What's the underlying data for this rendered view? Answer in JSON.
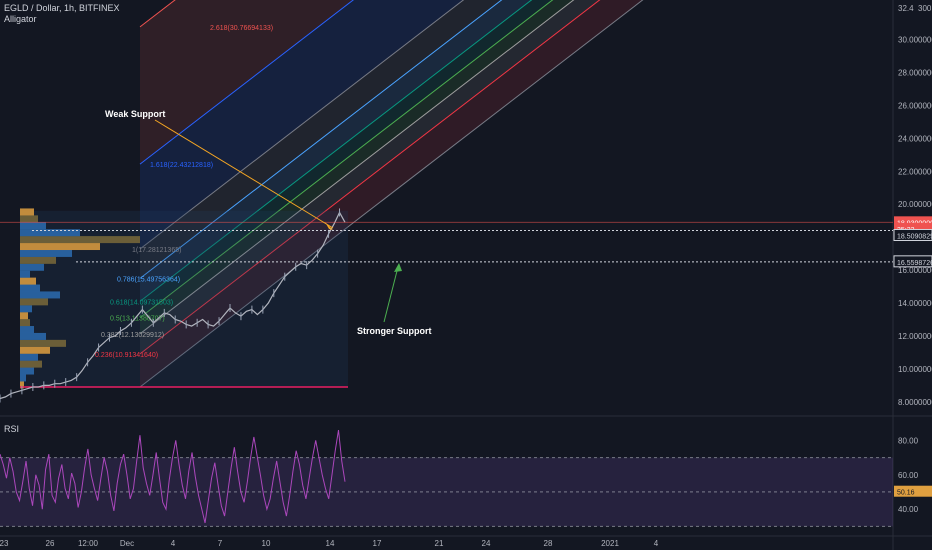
{
  "header": {
    "title": "EGLD / Dollar, 1h, BITFINEX",
    "indicator": "Alligator"
  },
  "rsi_label": "RSI",
  "colors": {
    "background": "#131722",
    "up": "#9aa3b5",
    "price_line": "#ef5350"
  },
  "chart_data": [
    {
      "type": "line",
      "name": "price",
      "ylim": [
        7.2,
        32.4
      ],
      "y_ticks": [
        8.0,
        10.0,
        12.0,
        14.0,
        16.0,
        18.0,
        20.0,
        22.0,
        24.0,
        26.0,
        28.0,
        30.0
      ],
      "y_tick_labels": [
        "8.00000000",
        "10.0000000",
        "12.0000000",
        "14.0000000",
        "16.0000000",
        "18.0000000",
        "20.0000000",
        "22.0000000",
        "24.0000000",
        "26.0000000",
        "28.0000000",
        "30.0000000"
      ],
      "top_tick_label": "32.4",
      "top_right_label": "300",
      "x_ticks": [
        "23",
        "26",
        "12:00",
        "Dec",
        "4",
        "7",
        "10",
        "14",
        "17",
        "21",
        "24",
        "28",
        "2021",
        "4"
      ],
      "price_badges": [
        {
          "value": 18.9,
          "text": "18.93000000",
          "color": "#ef5350"
        },
        {
          "value": 18.5,
          "text": "35:22",
          "color": "#ef5350"
        },
        {
          "value": 18.1,
          "text": "18.50908295",
          "color": "#d1d4dc"
        },
        {
          "value": 16.5,
          "text": "16.55987268",
          "color": "#d1d4dc"
        }
      ],
      "support_levels": [
        {
          "name": "Weak Support",
          "value": 18.4
        },
        {
          "name": "Stronger Support",
          "value": 16.5
        }
      ],
      "fib_levels": [
        {
          "ratio": 2.618,
          "value": 30.76694133,
          "label": "2.618(30.76694133)",
          "color": "#ef5350"
        },
        {
          "ratio": 1.618,
          "value": 22.43212818,
          "label": "1.618(22.43212818)",
          "color": "#2962ff"
        },
        {
          "ratio": 1.0,
          "value": 17.28121365,
          "label": "1(17.28121365)",
          "color": "#787b86"
        },
        {
          "ratio": 0.786,
          "value": 15.49756364,
          "label": "0.786(15.49756364)",
          "color": "#4aa3ff"
        },
        {
          "ratio": 0.618,
          "value": 14.09731503,
          "label": "0.618(14.09731503)",
          "color": "#089981"
        },
        {
          "ratio": 0.5,
          "value": 13.11380707,
          "label": "0.5(13.11380707)",
          "color": "#4caf50"
        },
        {
          "ratio": 0.382,
          "value": 12.13029912,
          "label": "0.382(12.13029912)",
          "color": "#9e9e9e"
        },
        {
          "ratio": 0.236,
          "value": 10.9134164,
          "label": "0.236(10.91341640)",
          "color": "#f23645"
        }
      ],
      "annotations": [
        {
          "text": "Weak Support"
        },
        {
          "text": "Stronger Support"
        }
      ],
      "close_series": [
        8.2,
        8.3,
        8.5,
        8.6,
        8.7,
        8.8,
        8.9,
        8.9,
        9.0,
        9.0,
        9.1,
        9.1,
        9.2,
        9.3,
        9.5,
        9.9,
        10.4,
        10.8,
        11.3,
        11.6,
        11.9,
        12.0,
        12.3,
        12.5,
        12.8,
        13.2,
        13.6,
        13.2,
        12.8,
        13.1,
        13.4,
        13.3,
        13.0,
        12.9,
        12.7,
        12.6,
        12.8,
        13.0,
        12.7,
        12.6,
        12.9,
        13.3,
        13.7,
        13.4,
        13.2,
        13.5,
        13.6,
        13.3,
        13.6,
        14.0,
        14.6,
        15.1,
        15.6,
        15.9,
        16.2,
        16.4,
        16.3,
        16.6,
        17.0,
        17.5,
        18.2,
        18.8,
        19.5,
        18.9
      ]
    },
    {
      "type": "line",
      "name": "RSI",
      "ylim": [
        25,
        93
      ],
      "y_ticks": [
        40,
        60,
        80
      ],
      "y_tick_labels": [
        "40.00",
        "60.00",
        "80.00"
      ],
      "bands": [
        30,
        70
      ],
      "mid": 50,
      "current": 50.16,
      "current_label": "50.16",
      "values": [
        72,
        66,
        58,
        70,
        62,
        50,
        45,
        56,
        68,
        52,
        42,
        60,
        54,
        40,
        63,
        72,
        48,
        44,
        58,
        66,
        52,
        46,
        61,
        55,
        41,
        50,
        64,
        75,
        60,
        52,
        45,
        58,
        70,
        62,
        48,
        39,
        55,
        66,
        72,
        60,
        46,
        52,
        68,
        83,
        64,
        55,
        48,
        60,
        73,
        58,
        44,
        40,
        57,
        70,
        80,
        66,
        54,
        46,
        62,
        73,
        59,
        48,
        40,
        32,
        45,
        58,
        67,
        54,
        42,
        36,
        50,
        64,
        76,
        62,
        50,
        44,
        56,
        70,
        82,
        71,
        60,
        48,
        40,
        46,
        58,
        68,
        56,
        44,
        36,
        48,
        62,
        74,
        66,
        54,
        46,
        58,
        70,
        80,
        70,
        60,
        52,
        46,
        60,
        74,
        86,
        68,
        56
      ]
    }
  ]
}
